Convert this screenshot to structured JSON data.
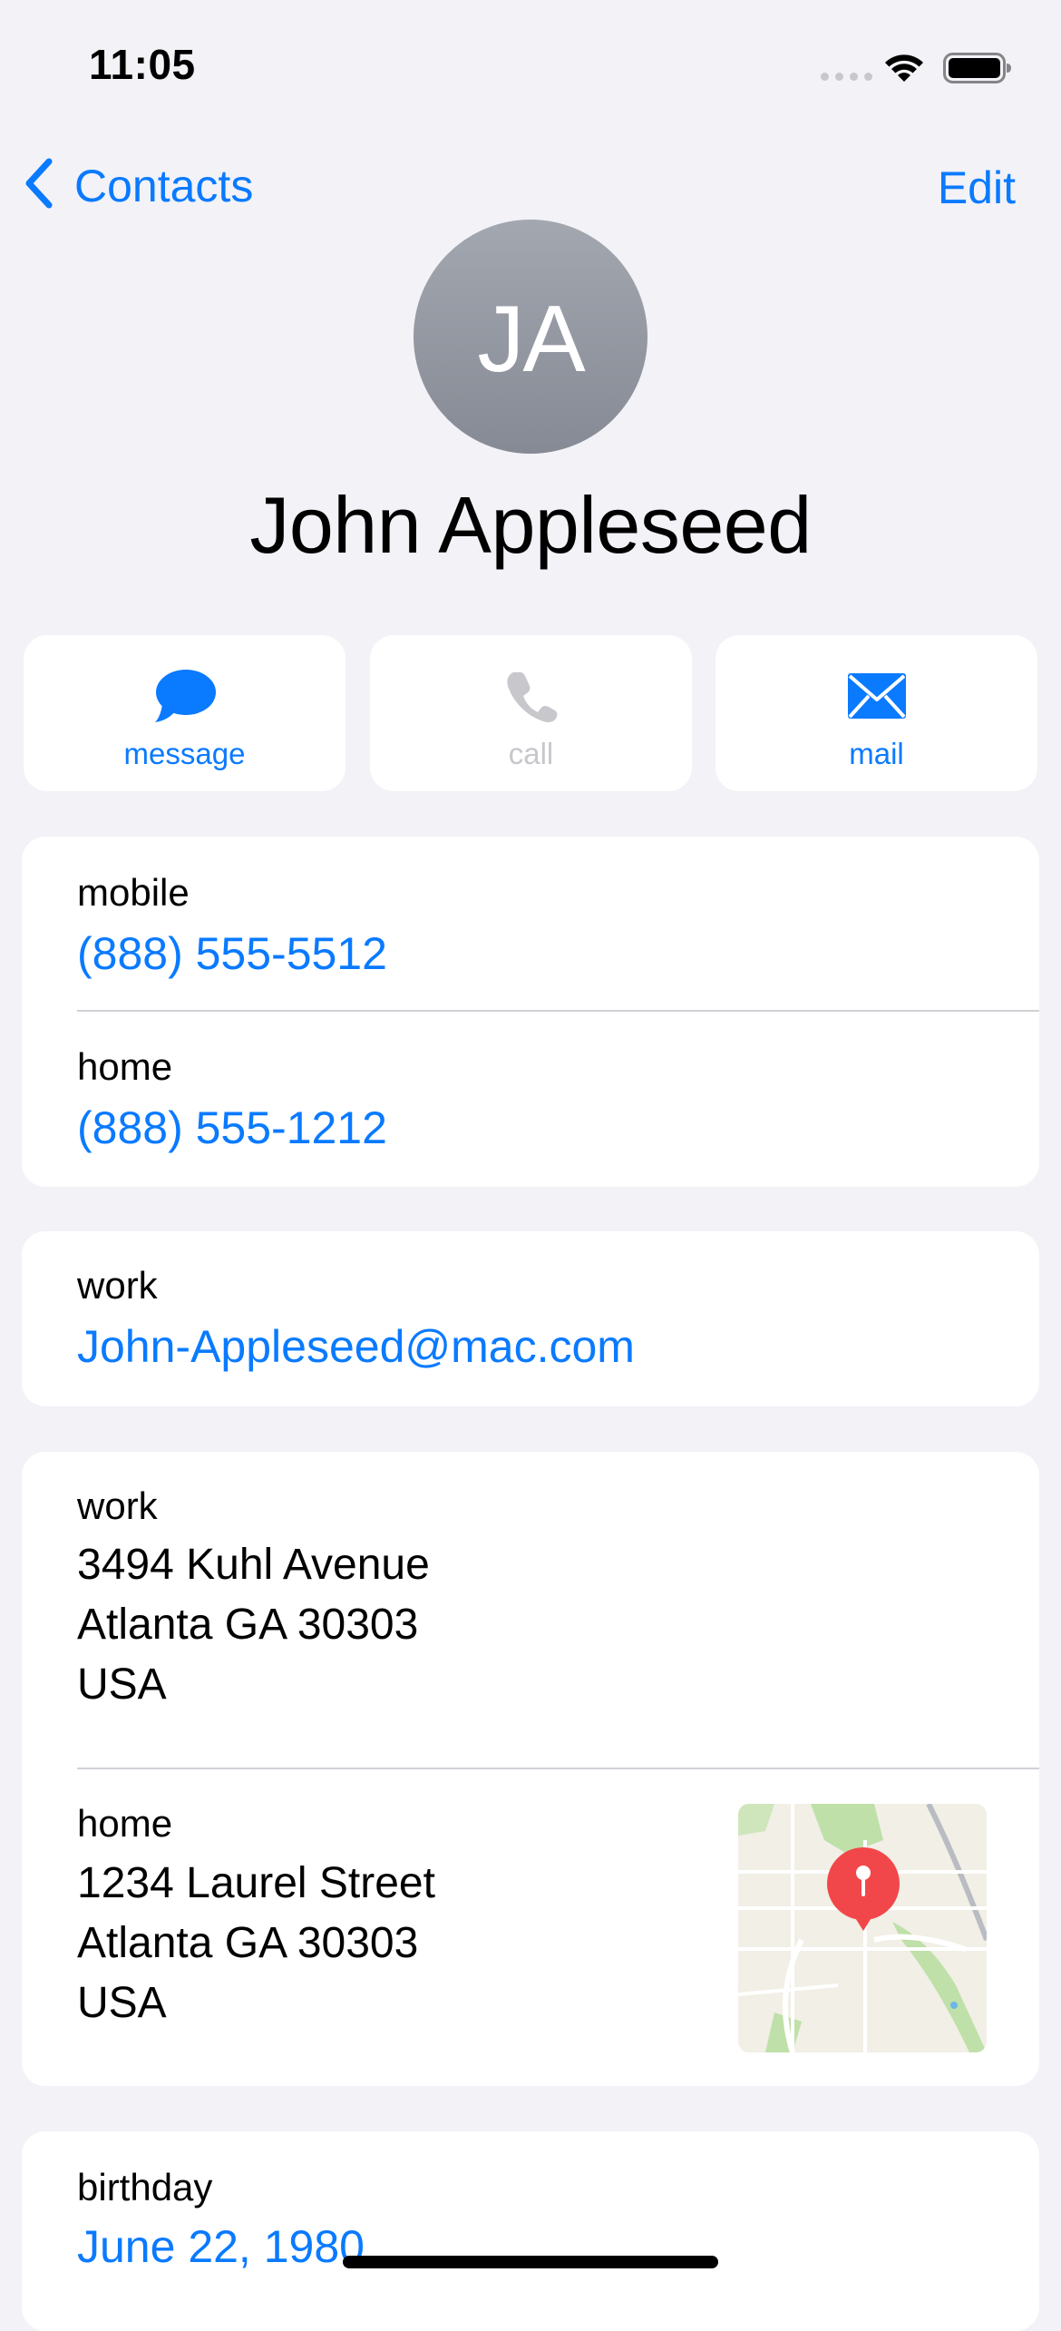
{
  "status_bar": {
    "time": "11:05"
  },
  "nav": {
    "back_label": "Contacts",
    "edit_label": "Edit"
  },
  "contact": {
    "initials": "JA",
    "name": "John Appleseed"
  },
  "actions": [
    {
      "label": "message",
      "icon": "message-bubble-icon",
      "enabled": true
    },
    {
      "label": "call",
      "icon": "phone-icon",
      "enabled": false
    },
    {
      "label": "mail",
      "icon": "envelope-icon",
      "enabled": true
    }
  ],
  "phones": [
    {
      "label": "mobile",
      "value": "(888) 555-5512"
    },
    {
      "label": "home",
      "value": "(888) 555-1212"
    }
  ],
  "email": {
    "label": "work",
    "value": "John-Appleseed@mac.com"
  },
  "addresses": [
    {
      "label": "work",
      "line1": "3494 Kuhl Avenue",
      "line2": "Atlanta GA 30303",
      "line3": "USA"
    },
    {
      "label": "home",
      "line1": "1234 Laurel Street",
      "line2": "Atlanta GA 30303",
      "line3": "USA"
    }
  ],
  "birthday": {
    "label": "birthday",
    "value": "June 22, 1980"
  },
  "colors": {
    "accent": "#0A7AFF",
    "background": "#F2F2F7",
    "card": "#FFFFFF",
    "disabled": "#C7C7CC",
    "map_pin": "#F2474A"
  }
}
